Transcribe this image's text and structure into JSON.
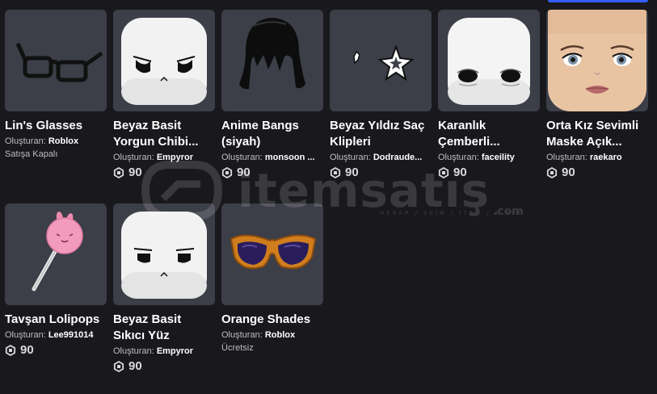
{
  "creator_prefix": "Oluşturan:",
  "items": [
    {
      "name": "Lin's Glasses",
      "creator": "Roblox",
      "status": "Satışa Kapalı",
      "price": null
    },
    {
      "name": "Beyaz Basit Yorgun Chibi...",
      "creator": "Empyror",
      "status": null,
      "price": "90"
    },
    {
      "name": "Anime Bangs (siyah)",
      "creator": "monsoon ...",
      "status": null,
      "price": "90"
    },
    {
      "name": "Beyaz Yıldız Saç Klipleri",
      "creator": "Dodraude...",
      "status": null,
      "price": "90"
    },
    {
      "name": "Karanlık Çemberli...",
      "creator": "faceility",
      "status": null,
      "price": "90"
    },
    {
      "name": "Orta Kız Sevimli Maske Açık...",
      "creator": "raekaro",
      "status": null,
      "price": "90"
    },
    {
      "name": "Tavşan Lolipops",
      "creator": "Lee991014",
      "status": null,
      "price": "90"
    },
    {
      "name": "Beyaz Basit Sıkıcı Yüz",
      "creator": "Empyror",
      "status": null,
      "price": "90"
    },
    {
      "name": "Orange Shades",
      "creator": "Roblox",
      "status": "Ücretsiz",
      "price": null
    }
  ],
  "watermark": {
    "text": "itemsatış",
    "sub": "HESAP / SKIN / ITEM / E-PIN",
    "suffix": ".com"
  },
  "icons": {
    "robux": "robux-icon",
    "accent": "#335fff"
  }
}
